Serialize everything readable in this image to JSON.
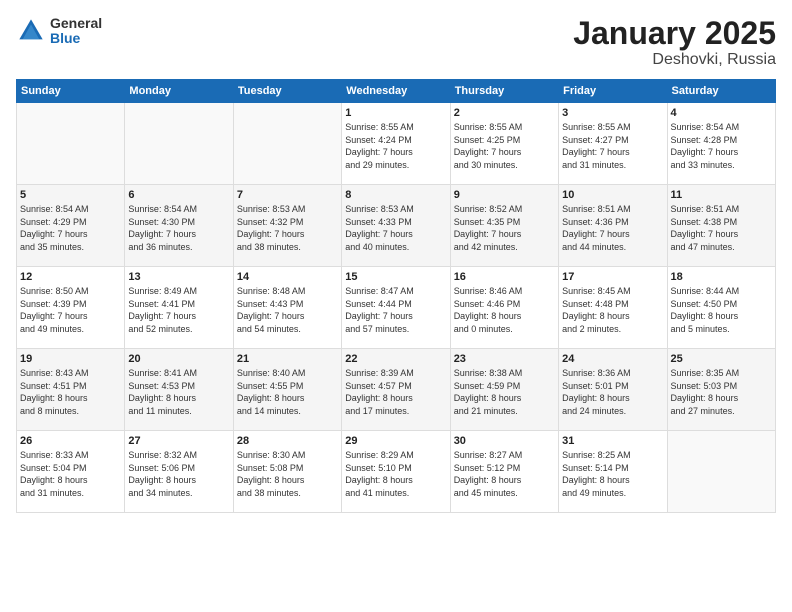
{
  "header": {
    "logo_general": "General",
    "logo_blue": "Blue",
    "title": "January 2025",
    "subtitle": "Deshovki, Russia"
  },
  "weekdays": [
    "Sunday",
    "Monday",
    "Tuesday",
    "Wednesday",
    "Thursday",
    "Friday",
    "Saturday"
  ],
  "weeks": [
    [
      {
        "day": "",
        "info": ""
      },
      {
        "day": "",
        "info": ""
      },
      {
        "day": "",
        "info": ""
      },
      {
        "day": "1",
        "info": "Sunrise: 8:55 AM\nSunset: 4:24 PM\nDaylight: 7 hours\nand 29 minutes."
      },
      {
        "day": "2",
        "info": "Sunrise: 8:55 AM\nSunset: 4:25 PM\nDaylight: 7 hours\nand 30 minutes."
      },
      {
        "day": "3",
        "info": "Sunrise: 8:55 AM\nSunset: 4:27 PM\nDaylight: 7 hours\nand 31 minutes."
      },
      {
        "day": "4",
        "info": "Sunrise: 8:54 AM\nSunset: 4:28 PM\nDaylight: 7 hours\nand 33 minutes."
      }
    ],
    [
      {
        "day": "5",
        "info": "Sunrise: 8:54 AM\nSunset: 4:29 PM\nDaylight: 7 hours\nand 35 minutes."
      },
      {
        "day": "6",
        "info": "Sunrise: 8:54 AM\nSunset: 4:30 PM\nDaylight: 7 hours\nand 36 minutes."
      },
      {
        "day": "7",
        "info": "Sunrise: 8:53 AM\nSunset: 4:32 PM\nDaylight: 7 hours\nand 38 minutes."
      },
      {
        "day": "8",
        "info": "Sunrise: 8:53 AM\nSunset: 4:33 PM\nDaylight: 7 hours\nand 40 minutes."
      },
      {
        "day": "9",
        "info": "Sunrise: 8:52 AM\nSunset: 4:35 PM\nDaylight: 7 hours\nand 42 minutes."
      },
      {
        "day": "10",
        "info": "Sunrise: 8:51 AM\nSunset: 4:36 PM\nDaylight: 7 hours\nand 44 minutes."
      },
      {
        "day": "11",
        "info": "Sunrise: 8:51 AM\nSunset: 4:38 PM\nDaylight: 7 hours\nand 47 minutes."
      }
    ],
    [
      {
        "day": "12",
        "info": "Sunrise: 8:50 AM\nSunset: 4:39 PM\nDaylight: 7 hours\nand 49 minutes."
      },
      {
        "day": "13",
        "info": "Sunrise: 8:49 AM\nSunset: 4:41 PM\nDaylight: 7 hours\nand 52 minutes."
      },
      {
        "day": "14",
        "info": "Sunrise: 8:48 AM\nSunset: 4:43 PM\nDaylight: 7 hours\nand 54 minutes."
      },
      {
        "day": "15",
        "info": "Sunrise: 8:47 AM\nSunset: 4:44 PM\nDaylight: 7 hours\nand 57 minutes."
      },
      {
        "day": "16",
        "info": "Sunrise: 8:46 AM\nSunset: 4:46 PM\nDaylight: 8 hours\nand 0 minutes."
      },
      {
        "day": "17",
        "info": "Sunrise: 8:45 AM\nSunset: 4:48 PM\nDaylight: 8 hours\nand 2 minutes."
      },
      {
        "day": "18",
        "info": "Sunrise: 8:44 AM\nSunset: 4:50 PM\nDaylight: 8 hours\nand 5 minutes."
      }
    ],
    [
      {
        "day": "19",
        "info": "Sunrise: 8:43 AM\nSunset: 4:51 PM\nDaylight: 8 hours\nand 8 minutes."
      },
      {
        "day": "20",
        "info": "Sunrise: 8:41 AM\nSunset: 4:53 PM\nDaylight: 8 hours\nand 11 minutes."
      },
      {
        "day": "21",
        "info": "Sunrise: 8:40 AM\nSunset: 4:55 PM\nDaylight: 8 hours\nand 14 minutes."
      },
      {
        "day": "22",
        "info": "Sunrise: 8:39 AM\nSunset: 4:57 PM\nDaylight: 8 hours\nand 17 minutes."
      },
      {
        "day": "23",
        "info": "Sunrise: 8:38 AM\nSunset: 4:59 PM\nDaylight: 8 hours\nand 21 minutes."
      },
      {
        "day": "24",
        "info": "Sunrise: 8:36 AM\nSunset: 5:01 PM\nDaylight: 8 hours\nand 24 minutes."
      },
      {
        "day": "25",
        "info": "Sunrise: 8:35 AM\nSunset: 5:03 PM\nDaylight: 8 hours\nand 27 minutes."
      }
    ],
    [
      {
        "day": "26",
        "info": "Sunrise: 8:33 AM\nSunset: 5:04 PM\nDaylight: 8 hours\nand 31 minutes."
      },
      {
        "day": "27",
        "info": "Sunrise: 8:32 AM\nSunset: 5:06 PM\nDaylight: 8 hours\nand 34 minutes."
      },
      {
        "day": "28",
        "info": "Sunrise: 8:30 AM\nSunset: 5:08 PM\nDaylight: 8 hours\nand 38 minutes."
      },
      {
        "day": "29",
        "info": "Sunrise: 8:29 AM\nSunset: 5:10 PM\nDaylight: 8 hours\nand 41 minutes."
      },
      {
        "day": "30",
        "info": "Sunrise: 8:27 AM\nSunset: 5:12 PM\nDaylight: 8 hours\nand 45 minutes."
      },
      {
        "day": "31",
        "info": "Sunrise: 8:25 AM\nSunset: 5:14 PM\nDaylight: 8 hours\nand 49 minutes."
      },
      {
        "day": "",
        "info": ""
      }
    ]
  ]
}
